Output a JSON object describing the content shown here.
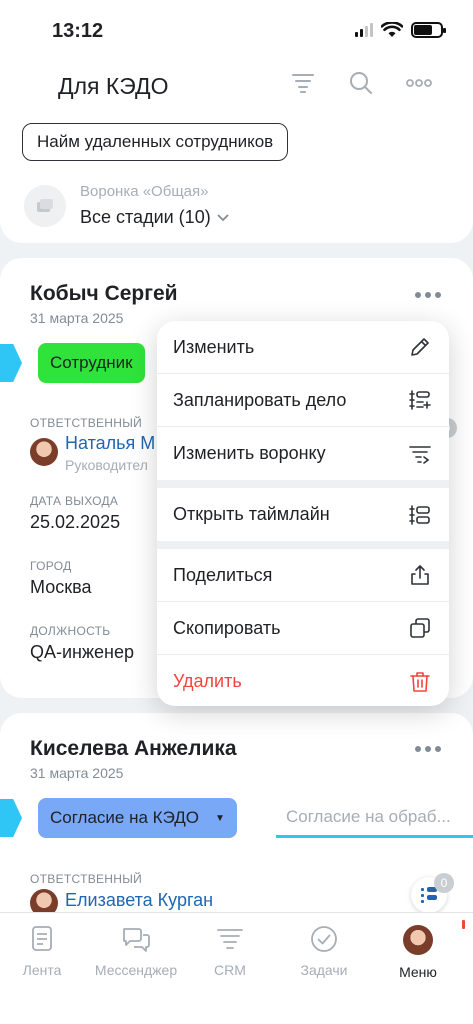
{
  "status": {
    "time": "13:12"
  },
  "header": {
    "title": "Для КЭДО",
    "chip_label": "Найм удаленных сотрудников",
    "funnel_label": "Воронка «Общая»",
    "funnel_value": "Все стадии (10)"
  },
  "cards": [
    {
      "name": "Кобыч Сергей",
      "date": "31 марта 2025",
      "stage": "Сотрудник",
      "responsible_label": "ОТВЕТСТВЕННЫЙ",
      "responsible_name": "Наталья М",
      "responsible_role": "Руководител",
      "exit_label": "ДАТА ВЫХОДА",
      "exit_value": "25.02.2025",
      "city_label": "ГОРОД",
      "city_value": "Москва",
      "position_label": "ДОЛЖНОСТЬ",
      "position_value": "QA-инженер",
      "side_count": "0"
    },
    {
      "name": "Киселева Анжелика",
      "date": "31 марта 2025",
      "stage": "Согласие на КЭДО",
      "next_stage": "Согласие на обраб...",
      "responsible_label": "ОТВЕТСТВЕННЫЙ",
      "responsible_name": "Елизавета Курган",
      "side_count": "0"
    }
  ],
  "context_menu": {
    "items": [
      {
        "label": "Изменить",
        "icon": "pencil-icon"
      },
      {
        "label": "Запланировать дело",
        "icon": "plan-task-icon"
      },
      {
        "label": "Изменить воронку",
        "icon": "change-funnel-icon"
      },
      {
        "label": "Открыть таймлайн",
        "icon": "timeline-icon"
      },
      {
        "label": "Поделиться",
        "icon": "share-icon"
      },
      {
        "label": "Скопировать",
        "icon": "copy-icon"
      },
      {
        "label": "Удалить",
        "icon": "trash-icon"
      }
    ]
  },
  "tabbar": {
    "tabs": [
      {
        "label": "Лента",
        "icon": "feed-icon"
      },
      {
        "label": "Мессенджер",
        "icon": "messenger-icon"
      },
      {
        "label": "CRM",
        "icon": "crm-icon"
      },
      {
        "label": "Задачи",
        "icon": "tasks-icon"
      },
      {
        "label": "Меню",
        "icon": "avatar"
      }
    ],
    "active": "Меню"
  },
  "colors": {
    "accent": "#2fc6f6",
    "stage_green": "#30e33a",
    "stage_blue": "#79a8f7",
    "link": "#2067b0",
    "danger": "#f0453a"
  }
}
